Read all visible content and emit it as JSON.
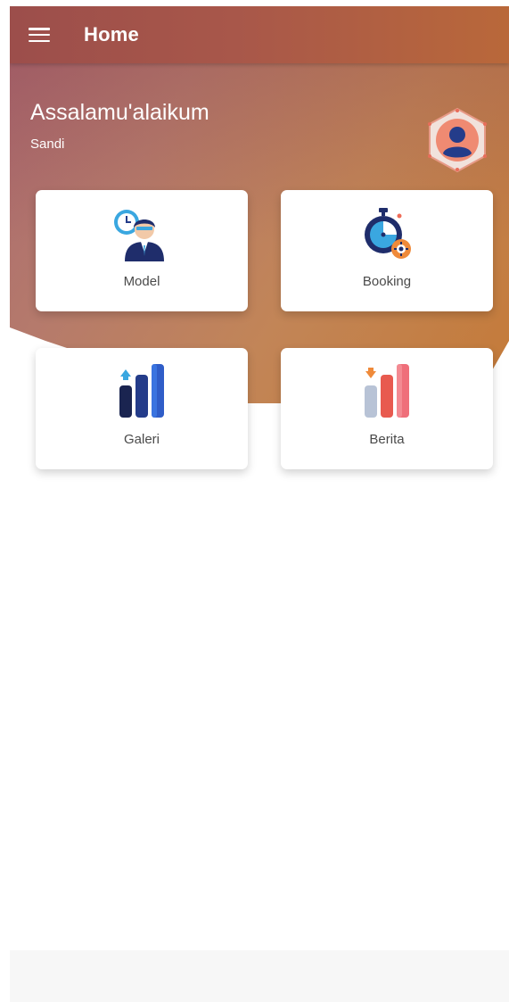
{
  "app_bar": {
    "title": "Home",
    "menu_icon": "hamburger-menu-icon"
  },
  "header": {
    "greeting": "Assalamu'alaikum",
    "username": "Sandi",
    "avatar_icon": "user-avatar-icon"
  },
  "menu": [
    {
      "label": "Model",
      "icon": "model-person-clock-icon"
    },
    {
      "label": "Booking",
      "icon": "booking-stopwatch-icon"
    },
    {
      "label": "Galeri",
      "icon": "gallery-bar-chart-icon"
    },
    {
      "label": "Berita",
      "icon": "news-bar-chart-icon"
    }
  ],
  "colors": {
    "primary": "#a8574a",
    "accent": "#c47a38",
    "card_text": "#4a4a4a"
  }
}
